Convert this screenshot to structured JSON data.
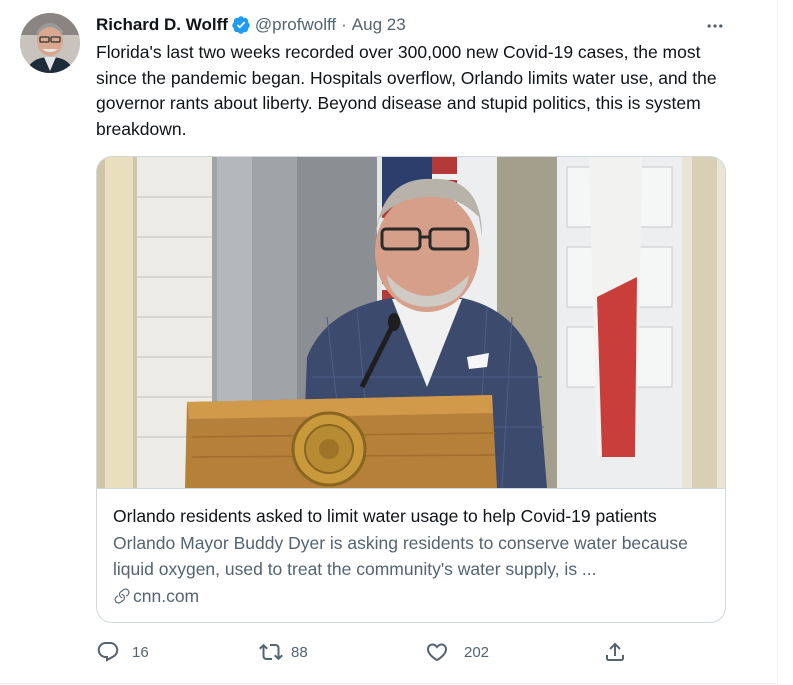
{
  "tweet": {
    "author_name": "Richard D. Wolff",
    "handle": "@profwolff",
    "separator": "·",
    "date": "Aug 23",
    "text": "Florida's last two weeks recorded over 300,000 new Covid-19 cases, the most since the pandemic began. Hospitals overflow, Orlando limits water use, and the governor rants about liberty. Beyond disease and stupid politics, this is system breakdown.",
    "verified": true
  },
  "card": {
    "title": "Orlando residents asked to limit water usage to help Covid-19 patients",
    "description": "Orlando Mayor Buddy Dyer is asking residents to conserve water because liquid oxygen, used to treat the community's water supply, is ...",
    "domain": "cnn.com"
  },
  "actions": {
    "replies": "16",
    "retweets": "88",
    "likes": "202"
  },
  "icons": [
    "verified-badge-icon",
    "more-icon",
    "link-icon",
    "reply-icon",
    "retweet-icon",
    "like-icon",
    "share-icon"
  ],
  "colors": {
    "text": "#0f1419",
    "secondary": "#536471",
    "verified": "#1d9bf0",
    "border": "#cfd9de"
  }
}
